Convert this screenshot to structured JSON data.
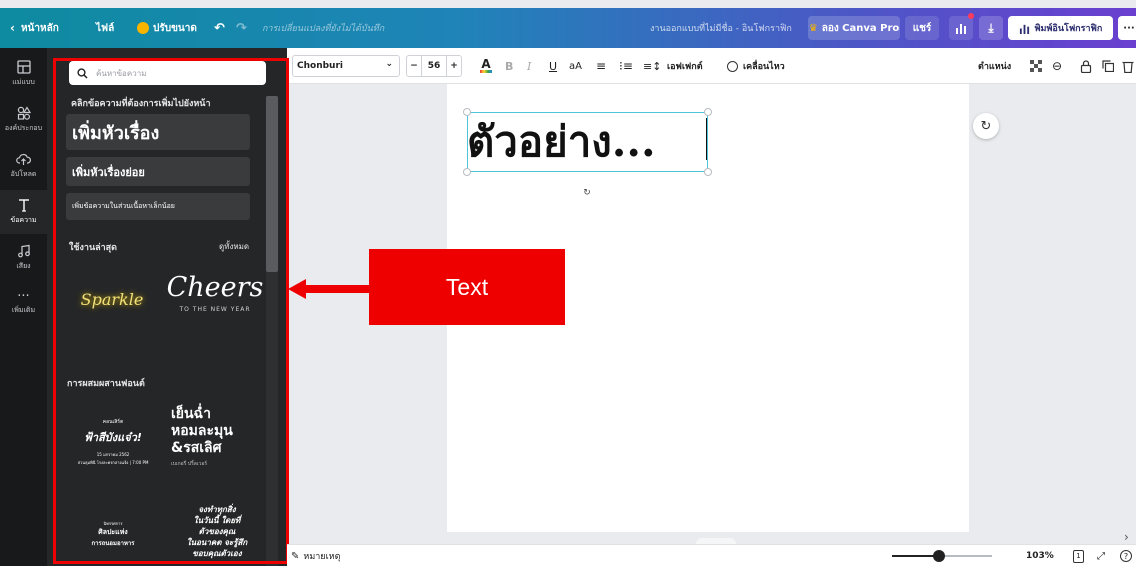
{
  "topbar": {
    "back_label": "หน้าหลัก",
    "file_label": "ไฟล์",
    "resize_label": "ปรับขนาด",
    "unsaved_label": "การเปลี่ยนแปลงที่ยังไม่ได้บันทึก",
    "doc_title": "งานออกแบบที่ไม่มีชื่อ - อินโฟกราฟิก",
    "try_pro_label": "ลอง Canva Pro",
    "share_label": "แชร์",
    "print_label": "พิมพ์อินโฟกราฟิก",
    "more_label": "···"
  },
  "rail": {
    "items": [
      {
        "label": "แม่แบบ",
        "icon": "template-icon"
      },
      {
        "label": "องค์ประกอบ",
        "icon": "elements-icon"
      },
      {
        "label": "อัปโหลด",
        "icon": "upload-icon"
      },
      {
        "label": "ข้อความ",
        "icon": "text-icon"
      },
      {
        "label": "เสียง",
        "icon": "music-icon"
      },
      {
        "label": "เพิ่มเติม",
        "icon": "more-icon"
      }
    ]
  },
  "panel": {
    "search_placeholder": "ค้นหาข้อความ",
    "intro": "คลิกข้อความที่ต้องการเพิ่มไปยังหน้า",
    "add_heading": "เพิ่มหัวเรื่อง",
    "add_subheading": "เพิ่มหัวเรื่องย่อย",
    "add_body": "เพิ่มข้อความในส่วนเนื้อหาเล็กน้อย",
    "recent_title": "ใช้งานล่าสุด",
    "see_all": "ดูทั้งหมด",
    "recent_items": [
      "Sparkle",
      "Cheers",
      "TO THE NEW YEAR"
    ],
    "combos_title": "การผสมผสานฟอนต์",
    "combo1": {
      "small": "คอนเสิร์ต",
      "title": "ฟ้าสีบังแจ๋ว!",
      "date": "15 มกราคม 2562",
      "time": "สวนลุมพินี โรงละครกลางแจ้ง | 7:00 PM"
    },
    "combo2": {
      "line1": "เย็นฉ่ำ",
      "line2": "หอมละมุน",
      "line3": "&รสเลิศ",
      "small": "เบเกอรี่ ปริ้ลเวอร์"
    },
    "combo3": {
      "small": "นิทรรศการ",
      "line1": "ศิลปะแห่ง",
      "line2": "การถนอมอาหาร"
    },
    "combo4": {
      "line1": "จงทำทุกสิ่ง",
      "line2": "ในวันนี้ ใดยที่",
      "line3": "ตัวของคุณ",
      "line4": "ในอนาคต จะรู้สึก",
      "line5": "ขอบคุณตัวเอง"
    }
  },
  "annotation": {
    "label": "Text",
    "color": "#ee0000"
  },
  "toolbar": {
    "font_name": "Chonburi",
    "font_size": "56",
    "effects_label": "เอฟเฟกต์",
    "animate_label": "เคลื่อนไหว",
    "position_label": "ตำแหน่ง"
  },
  "canvas": {
    "sample_text": "ตัวอย่าง..."
  },
  "footer": {
    "notes_label": "หมายเหตุ",
    "zoom": "103%",
    "page_count": "1",
    "zoom_level": 0.47
  },
  "colors": {
    "accent": "#4fc3d9",
    "topbar_start": "#0e8ba0",
    "topbar_end": "#6a3fd0",
    "panel": "#252627"
  }
}
